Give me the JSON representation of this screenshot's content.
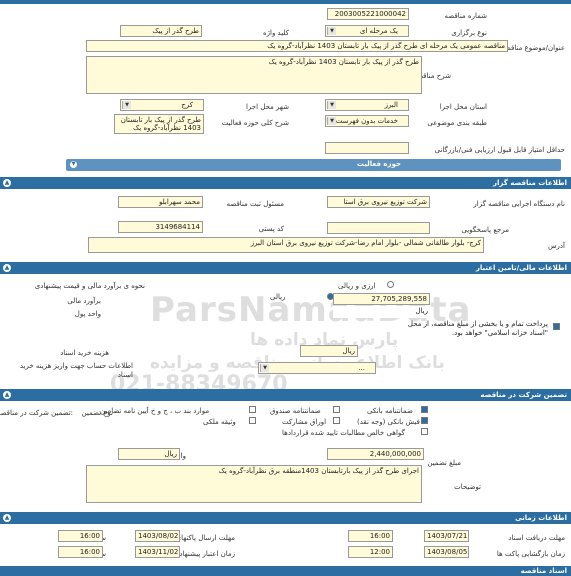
{
  "general": {
    "tender_number_label": "شماره مناقصه",
    "tender_number": "2003005221000042",
    "holding_type_label": "نوع برگزاری",
    "holding_type": "یک مرحله ای",
    "keyword_label": "کلید واژه",
    "keyword": "طرح گذر از پیک",
    "title_label": "عنوان/موضوع مناقصه",
    "title": "مناقصه عمومی یک مرحله ای طرح گذر از پیک بار تابستان 1403 نظرآباد-گروه یک",
    "description_label": "شرح مناقصه",
    "description": "طرح گذر از پیک بار تابستان 1403 نظرآباد-گروه یک",
    "province_label": "استان محل اجرا",
    "province": "البرز",
    "city_label": "شهر محل اجرا",
    "city": "کرج",
    "category_label": "طبقه بندی موضوعی",
    "category": "خدمات بدون فهرست بها",
    "activity_scope_label": "شرح کلی حوزه فعالیت",
    "activity_scope": "طرح گذر از پیک بار تابستان 1403 نظرآباد-گروه یک",
    "min_score_label": "حداقل امتیاز قابل قبول ارزیابی فنی/بازرگانی",
    "activity_field_bar": "حوزه فعالیت"
  },
  "organizer_section": {
    "header": "اطلاعات مناقصه گزار",
    "org_name_label": "نام دستگاه اجرایی مناقصه گزار",
    "org_name": "شرکت توزیع نیروی برق استا",
    "officer_label": "مسئول ثبت مناقصه",
    "officer": "محمد سهرابلو",
    "reference_label": "مرجع پاسخگویی",
    "postal_label": "کد پستی",
    "postal_code": "3149684114",
    "address_label": "آدرس",
    "address": "کرج- بلوار طالقانی شمالی -بلوار امام رضا-شرکت توزیع نیروی برق استان البرز"
  },
  "finance_section": {
    "header": "اطلاعات مالی/تامین اعتبار",
    "estimate_method_label": "نحوه ی برآورد مالی و قیمت پیشنهادی",
    "estimate_method": "ارزی و ریالی",
    "option_currency": "ارزی و ریالی",
    "option_rial": "ریالی",
    "estimate_label": "برآورد مالی",
    "estimate_value": "27,705,289,558",
    "currency_unit_label": "واحد پول",
    "currency_unit": "ریال",
    "payment_note": "پرداخت تمام و یا بخشی از مبلغ مناقصه، از محل \"اسناد خزانه اسلامی\" خواهد بود.",
    "doc_fee_label": "هزینه خرید اسناد",
    "doc_fee_unit": "ریال",
    "account_label": "اطلاعات حساب جهت واریز هزینه خرید اسناد",
    "account_value": "..."
  },
  "guarantee_section": {
    "header": "تضمین شرکت در مناقصه",
    "header_side": "تضمین شرکت در مناقصه:",
    "type_label": "نوع تضمین",
    "options": [
      "ضمانتنامه بانکی",
      "ضمانتنامه صندوق",
      "موارد بند ب ، ج و خ آیین نامه تضامین",
      "فیش بانکی (وجه نقد)",
      "اوراق مشارکت",
      "وثیقه ملکی",
      "گواهی خالص مطالبات تایید شده قراردادها"
    ],
    "amount_label": "مبلغ تضمین",
    "amount": "2,440,000,000",
    "unit_label": "واحد پول",
    "unit": "ریال",
    "notes_label": "توضیحات",
    "notes": "اجرای طرح گذر از پیک بارتابستان 1403منطقه برق نظرآباد-گروه یک"
  },
  "timing_section": {
    "header": "اطلاعات زمانی",
    "doc_receive_label": "مهلت دریافت اسناد",
    "doc_receive_date": "1403/07/21",
    "doc_receive_time": "16:00",
    "submit_label": "مهلت ارسال پاکتهای پیشنهاد",
    "submit_date": "1403/08/02",
    "submit_time": "16:00",
    "opening_label": "زمان بازگشایی پاکت ها",
    "opening_date": "1403/08/05",
    "opening_time": "12:00",
    "validity_label": "زمان اعتبار پیشنهاد",
    "validity_date": "1403/11/02",
    "validity_time": "16:00",
    "time_label": "ساعت"
  },
  "footer": {
    "header": "اسناد مناقصه"
  },
  "watermark": {
    "line1": "ParsNamadData",
    "line2": "پارس نماد داده ها",
    "line3": "بانک اطلاع رسانی مناقصه و مزایده",
    "line4": "021-88349670"
  }
}
